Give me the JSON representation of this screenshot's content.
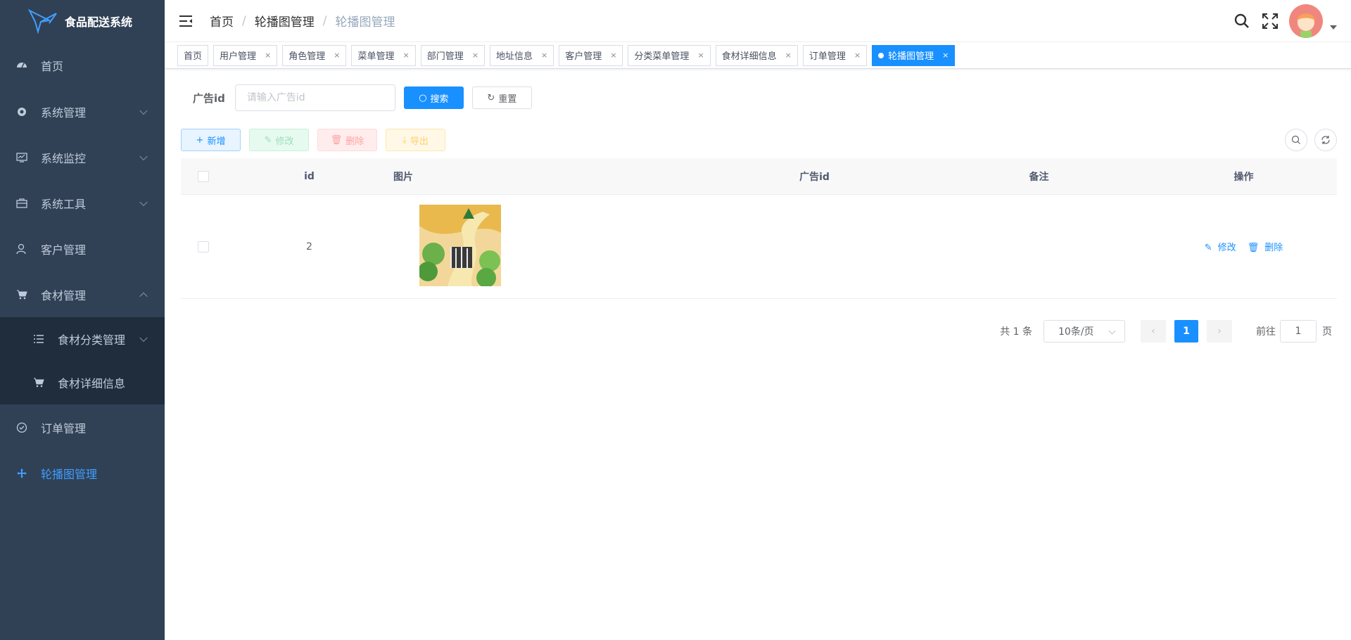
{
  "app": {
    "title": "食品配送系统"
  },
  "sidebar": {
    "items": [
      {
        "label": "首页",
        "icon": "dashboard-icon"
      },
      {
        "label": "系统管理",
        "icon": "gear-icon"
      },
      {
        "label": "系统监控",
        "icon": "monitor-icon"
      },
      {
        "label": "系统工具",
        "icon": "toolbox-icon"
      },
      {
        "label": "客户管理",
        "icon": "user-icon"
      },
      {
        "label": "食材管理",
        "icon": "cart-icon"
      },
      {
        "label": "食材分类管理",
        "icon": "list-icon"
      },
      {
        "label": "食材详细信息",
        "icon": "cart-icon"
      },
      {
        "label": "订单管理",
        "icon": "clock-icon"
      },
      {
        "label": "轮播图管理",
        "icon": "move-icon"
      }
    ]
  },
  "breadcrumb": [
    "首页",
    "/",
    "轮播图管理",
    "/",
    "轮播图管理"
  ],
  "tags": [
    "首页",
    "用户管理",
    "角色管理",
    "菜单管理",
    "部门管理",
    "地址信息",
    "客户管理",
    "分类菜单管理",
    "食材详细信息",
    "订单管理",
    "轮播图管理"
  ],
  "tag_close": "×",
  "search": {
    "label": "广告id",
    "placeholder": "请输入广告id",
    "search_btn": "搜索",
    "reset_btn": "重置"
  },
  "toolbar": {
    "add": "新增",
    "edit": "修改",
    "delete": "删除",
    "export": "导出"
  },
  "table": {
    "headers": [
      "id",
      "图片",
      "广告id",
      "备注",
      "操作"
    ],
    "rows": [
      {
        "id": "2",
        "ad_id": "",
        "remark": "",
        "op_edit": "修改",
        "op_delete": "删除"
      }
    ]
  },
  "pagination": {
    "total": "共 1 条",
    "page_size": "10条/页",
    "current": "1",
    "goto_prefix": "前往",
    "goto_value": "1",
    "goto_suffix": "页"
  },
  "colors": {
    "sidebar_bg": "#304156",
    "primary": "#1890ff",
    "active_menu": "#409eff"
  }
}
